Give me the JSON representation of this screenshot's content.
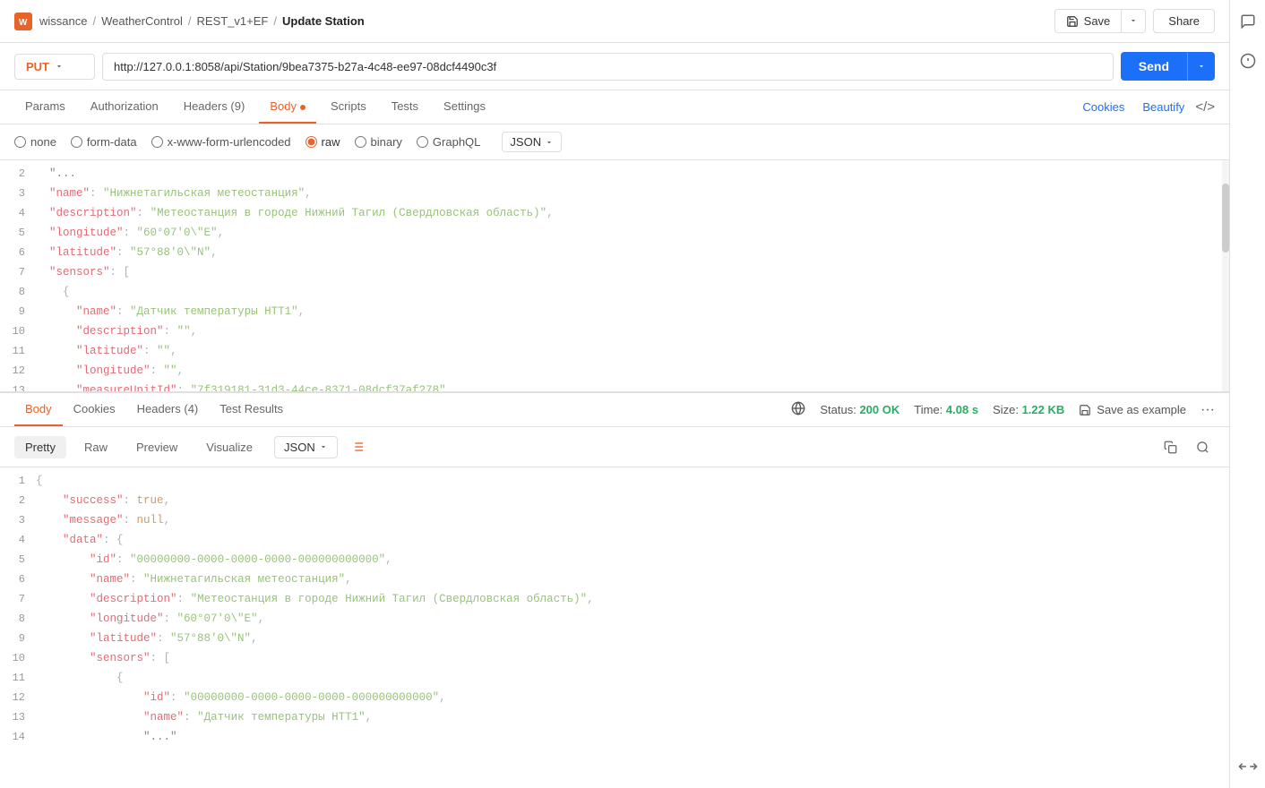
{
  "header": {
    "logo_text": "W",
    "breadcrumb": [
      "wissance",
      "WeatherControl",
      "REST_v1+EF",
      "Update Station"
    ],
    "separators": [
      "/",
      "/",
      "/"
    ],
    "save_label": "Save",
    "share_label": "Share"
  },
  "url_bar": {
    "method": "PUT",
    "url": "http://127.0.0.1:8058/api/Station/9bea7375-b27a-4c48-ee97-08dcf4490c3f",
    "send_label": "Send"
  },
  "request_tabs": {
    "tabs": [
      "Params",
      "Authorization",
      "Headers (9)",
      "Body",
      "Scripts",
      "Tests",
      "Settings"
    ],
    "active": "Body",
    "cookies_label": "Cookies",
    "beautify_label": "Beautify"
  },
  "body_types": {
    "options": [
      "none",
      "form-data",
      "x-www-form-urlencoded",
      "raw",
      "binary",
      "GraphQL"
    ],
    "active": "raw",
    "format": "JSON"
  },
  "request_body": {
    "lines": [
      {
        "num": 2,
        "content": "  \"...\""
      },
      {
        "num": 3,
        "content": "  \"name\": \"Нижнетагильская метеостанция\","
      },
      {
        "num": 4,
        "content": "  \"description\": \"Метеостанция в городе Нижний Тагил (Свердловская область)\","
      },
      {
        "num": 5,
        "content": "  \"longitude\": \"60°07'0\\\"E\","
      },
      {
        "num": 6,
        "content": "  \"latitude\": \"57°88'0\\\"N\","
      },
      {
        "num": 7,
        "content": "  \"sensors\": ["
      },
      {
        "num": 8,
        "content": "    {"
      },
      {
        "num": 9,
        "content": "      \"name\": \"Датчик температуры НТТ1\","
      },
      {
        "num": 10,
        "content": "      \"description\": \"\","
      },
      {
        "num": 11,
        "content": "      \"latitude\": \"\","
      },
      {
        "num": 12,
        "content": "      \"longitude\": \"\","
      },
      {
        "num": 13,
        "content": "      \"measureUnitId\": \"7f319181-31d3-44ce-8371-08dcf37af278\""
      }
    ]
  },
  "response": {
    "tabs": [
      "Body",
      "Cookies",
      "Headers (4)",
      "Test Results"
    ],
    "active": "Body",
    "status_label": "Status:",
    "status_value": "200 OK",
    "time_label": "Time:",
    "time_value": "4.08 s",
    "size_label": "Size:",
    "size_value": "1.22 KB",
    "save_example_label": "Save as example",
    "format_tabs": [
      "Pretty",
      "Raw",
      "Preview",
      "Visualize"
    ],
    "active_format": "Pretty",
    "json_format": "JSON",
    "body_lines": [
      {
        "num": 1,
        "content": "{"
      },
      {
        "num": 2,
        "content": "    \"success\": true,"
      },
      {
        "num": 3,
        "content": "    \"message\": null,"
      },
      {
        "num": 4,
        "content": "    \"data\": {"
      },
      {
        "num": 5,
        "content": "        \"id\": \"00000000-0000-0000-0000-000000000000\","
      },
      {
        "num": 6,
        "content": "        \"name\": \"Нижнетагильская метеостанция\","
      },
      {
        "num": 7,
        "content": "        \"description\": \"Метеостанция в городе Нижний Тагил (Свердловская область)\","
      },
      {
        "num": 8,
        "content": "        \"longitude\": \"60°07'0\\\"E\","
      },
      {
        "num": 9,
        "content": "        \"latitude\": \"57°88'0\\\"N\","
      },
      {
        "num": 10,
        "content": "        \"sensors\": ["
      },
      {
        "num": 11,
        "content": "            {"
      },
      {
        "num": 12,
        "content": "                \"id\": \"00000000-0000-0000-0000-000000000000\","
      },
      {
        "num": 13,
        "content": "                \"name\": \"Датчик температуры НТТ1\","
      },
      {
        "num": 14,
        "content": "                \"...\""
      }
    ]
  },
  "right_sidebar": {
    "icons": [
      "comment-icon",
      "info-icon",
      "resize-icon"
    ]
  }
}
